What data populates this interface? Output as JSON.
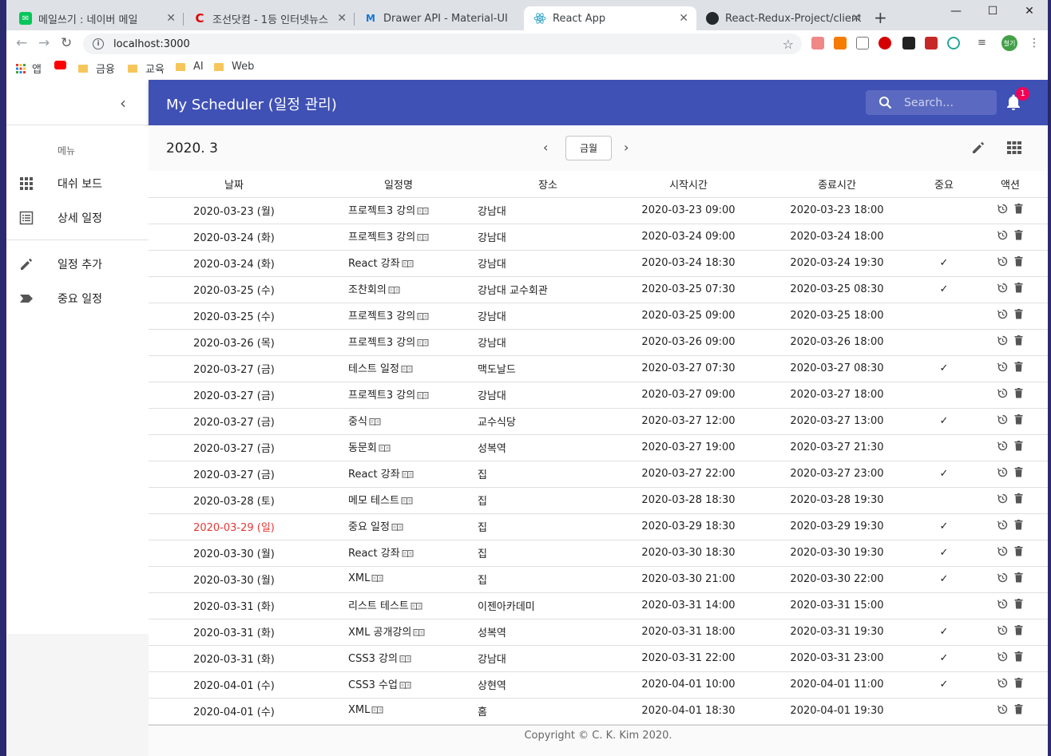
{
  "browser": {
    "tabs": [
      {
        "title": "메일쓰기 : 네이버 메일",
        "fav": "naver-mail-icon",
        "color": "#03c75a"
      },
      {
        "title": "조선닷컴 - 1등 인터넷뉴스",
        "fav": "chosun-icon",
        "color": "#e00000"
      },
      {
        "title": "Drawer API - Material-UI",
        "fav": "material-ui-icon",
        "color": "#1976d2"
      },
      {
        "title": "React App",
        "fav": "react-icon",
        "color": "#61dafb"
      },
      {
        "title": "React-Redux-Project/client/",
        "fav": "github-icon",
        "color": "#24292e"
      }
    ],
    "url": "localhost:3000",
    "bookmarks": [
      "앱",
      "금융",
      "교육",
      "AI",
      "Web"
    ],
    "profile": "철기"
  },
  "sidebar": {
    "caption": "메뉴",
    "items": [
      {
        "label": "대쉬 보드",
        "icon": "apps-grid-icon"
      },
      {
        "label": "상세 일정",
        "icon": "list-icon"
      },
      {
        "label": "일정 추가",
        "icon": "pencil-icon"
      },
      {
        "label": "중요 일정",
        "icon": "label-important-icon"
      }
    ]
  },
  "appbar": {
    "title": "My Scheduler (일정 관리)",
    "search_placeholder": "Search…",
    "notification_count": "1"
  },
  "controls": {
    "month": "2020. 3",
    "view_button": "금월"
  },
  "table": {
    "headers": [
      "날짜",
      "일정명",
      "장소",
      "시작시간",
      "종료시간",
      "중요",
      "액션"
    ],
    "rows": [
      {
        "date": "2020-03-23 (월)",
        "title": "프로젝트3 강의",
        "place": "강남대",
        "start": "2020-03-23 09:00",
        "end": "2020-03-23 18:00",
        "important": ""
      },
      {
        "date": "2020-03-24 (화)",
        "title": "프로젝트3 강의",
        "place": "강남대",
        "start": "2020-03-24 09:00",
        "end": "2020-03-24 18:00",
        "important": ""
      },
      {
        "date": "2020-03-24 (화)",
        "title": "React 강좌",
        "place": "강남대",
        "start": "2020-03-24 18:30",
        "end": "2020-03-24 19:30",
        "important": "✓"
      },
      {
        "date": "2020-03-25 (수)",
        "title": "조찬회의",
        "place": "강남대 교수회관",
        "start": "2020-03-25 07:30",
        "end": "2020-03-25 08:30",
        "important": "✓"
      },
      {
        "date": "2020-03-25 (수)",
        "title": "프로젝트3 강의",
        "place": "강남대",
        "start": "2020-03-25 09:00",
        "end": "2020-03-25 18:00",
        "important": ""
      },
      {
        "date": "2020-03-26 (목)",
        "title": "프로젝트3 강의",
        "place": "강남대",
        "start": "2020-03-26 09:00",
        "end": "2020-03-26 18:00",
        "important": ""
      },
      {
        "date": "2020-03-27 (금)",
        "title": "테스트 일정",
        "place": "맥도날드",
        "start": "2020-03-27 07:30",
        "end": "2020-03-27 08:30",
        "important": "✓"
      },
      {
        "date": "2020-03-27 (금)",
        "title": "프로젝트3 강의",
        "place": "강남대",
        "start": "2020-03-27 09:00",
        "end": "2020-03-27 18:00",
        "important": ""
      },
      {
        "date": "2020-03-27 (금)",
        "title": "중식",
        "place": "교수식당",
        "start": "2020-03-27 12:00",
        "end": "2020-03-27 13:00",
        "important": "✓"
      },
      {
        "date": "2020-03-27 (금)",
        "title": "동문회",
        "place": "성복역",
        "start": "2020-03-27 19:00",
        "end": "2020-03-27 21:30",
        "important": ""
      },
      {
        "date": "2020-03-27 (금)",
        "title": "React 강좌",
        "place": "집",
        "start": "2020-03-27 22:00",
        "end": "2020-03-27 23:00",
        "important": "✓"
      },
      {
        "date": "2020-03-28 (토)",
        "title": "메모 테스트",
        "place": "집",
        "start": "2020-03-28 18:30",
        "end": "2020-03-28 19:30",
        "important": ""
      },
      {
        "date": "2020-03-29 (일)",
        "title": "중요 일정",
        "place": "집",
        "start": "2020-03-29 18:30",
        "end": "2020-03-29 19:30",
        "important": "✓",
        "holiday": true
      },
      {
        "date": "2020-03-30 (월)",
        "title": "React 강좌",
        "place": "집",
        "start": "2020-03-30 18:30",
        "end": "2020-03-30 19:30",
        "important": "✓"
      },
      {
        "date": "2020-03-30 (월)",
        "title": "XML",
        "place": "집",
        "start": "2020-03-30 21:00",
        "end": "2020-03-30 22:00",
        "important": "✓"
      },
      {
        "date": "2020-03-31 (화)",
        "title": "리스트 테스트",
        "place": "이젠아카데미",
        "start": "2020-03-31 14:00",
        "end": "2020-03-31 15:00",
        "important": ""
      },
      {
        "date": "2020-03-31 (화)",
        "title": "XML 공개강의",
        "place": "성복역",
        "start": "2020-03-31 18:00",
        "end": "2020-03-31 19:30",
        "important": "✓"
      },
      {
        "date": "2020-03-31 (화)",
        "title": "CSS3 강의",
        "place": "강남대",
        "start": "2020-03-31 22:00",
        "end": "2020-03-31 23:00",
        "important": "✓"
      },
      {
        "date": "2020-04-01 (수)",
        "title": "CSS3 수업",
        "place": "상현역",
        "start": "2020-04-01 10:00",
        "end": "2020-04-01 11:00",
        "important": "✓"
      },
      {
        "date": "2020-04-01 (수)",
        "title": "XML",
        "place": "홈",
        "start": "2020-04-01 18:30",
        "end": "2020-04-01 19:30",
        "important": ""
      }
    ]
  },
  "footer": "Copyright © C. K. Kim 2020.",
  "colors": {
    "appbar": "#3f51b5",
    "badge": "#f50057",
    "holiday": "#e53935"
  }
}
